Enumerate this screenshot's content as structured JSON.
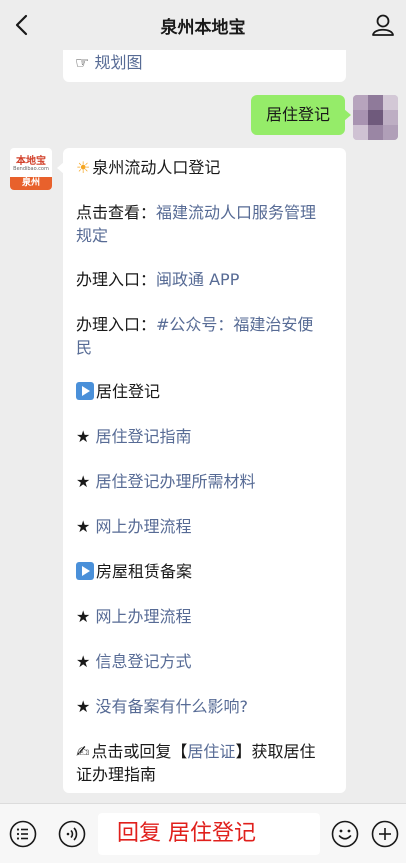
{
  "header": {
    "title": "泉州本地宝",
    "back_icon": "chevron-left-icon",
    "profile_icon": "person-icon"
  },
  "prev_message": {
    "prefix": "☞",
    "link": "规划图"
  },
  "user_message": {
    "text": "居住登记"
  },
  "bot": {
    "avatar_logo": "本地宝",
    "avatar_sub": "Bendibao.com",
    "avatar_city": "泉州"
  },
  "bot_message": {
    "title": "泉州流动人口登记",
    "l1_prefix": "点击查看：",
    "l1_link_a": "福建流动人口服务管理",
    "l1_link_b": "规定",
    "l2_prefix": "办理入口：",
    "l2_link": "闽政通 APP",
    "l3_prefix": "办理入口：",
    "l3_link_a": "#公众号：福建治安便",
    "l3_link_b": "民",
    "sec1_title": "居住登记",
    "sec1_items": [
      "居住登记指南",
      "居住登记办理所需材料",
      "网上办理流程"
    ],
    "sec2_title": "房屋租赁备案",
    "sec2_items": [
      "网上办理流程",
      "信息登记方式",
      "没有备案有什么影响?"
    ],
    "star": "★",
    "footer_a": "点击或回复【",
    "footer_link": "居住证",
    "footer_b": "】获取居住",
    "footer_c": "证办理指南"
  },
  "bottom_bar": {
    "reply_text": "回复 居住登记",
    "left_icons": [
      "menu-list-icon",
      "voice-icon"
    ],
    "right_icons": [
      "emoji-icon",
      "plus-icon"
    ]
  },
  "colors": {
    "background": "#ededed",
    "user_bubble": "#95ec69",
    "link": "#576b95",
    "reply_text": "#e0201c"
  }
}
